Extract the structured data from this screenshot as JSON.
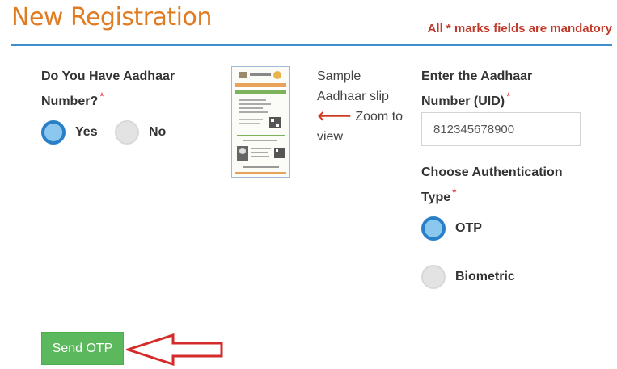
{
  "header": {
    "title": "New Registration",
    "mandatory_note": "All * marks fields are mandatory"
  },
  "aadhaar_question": {
    "label": "Do You Have Aadhaar Number?",
    "required_mark": "*",
    "options": [
      {
        "label": "Yes",
        "selected": true
      },
      {
        "label": "No",
        "selected": false
      }
    ]
  },
  "sample_slip": {
    "line1": "Sample",
    "line2": "Aadhaar slip",
    "zoom_arrow": "🡐",
    "zoom_text": "Zoom to",
    "line4": "view"
  },
  "uid_field": {
    "label": "Enter the Aadhaar Number (UID)",
    "required_mark": "*",
    "value": "812345678900"
  },
  "auth_type": {
    "label": "Choose Authentication Type",
    "required_mark": "*",
    "options": [
      {
        "label": "OTP",
        "selected": true
      },
      {
        "label": "Biometric",
        "selected": false
      }
    ]
  },
  "actions": {
    "send_otp_label": "Send OTP"
  },
  "colors": {
    "title": "#e07b22",
    "mandatory": "#c0392b",
    "accent": "#2a80c8",
    "button": "#5cb85c",
    "annotation_arrow": "#d42a2a"
  }
}
